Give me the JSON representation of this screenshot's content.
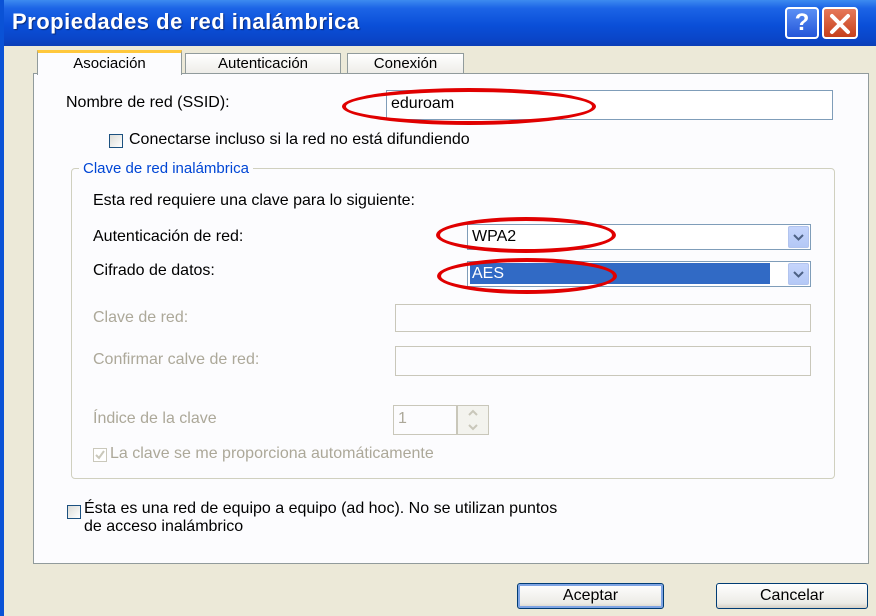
{
  "window": {
    "title": "Propiedades de red inalámbrica",
    "help_label": "?"
  },
  "tabs": [
    {
      "label": "Asociación"
    },
    {
      "label": "Autenticación"
    },
    {
      "label": "Conexión"
    }
  ],
  "ssid": {
    "label": "Nombre de red (SSID):",
    "value": "eduroam"
  },
  "broadcast_checkbox": {
    "label": "Conectarse incluso si la red no está difundiendo",
    "checked": false
  },
  "key_group": {
    "title": "Clave de red inalámbrica",
    "intro": "Esta red requiere una clave para lo siguiente:",
    "auth": {
      "label": "Autenticación de red:",
      "value": "WPA2"
    },
    "encryption": {
      "label": "Cifrado de datos:",
      "value": "AES"
    },
    "network_key": {
      "label": "Clave de red:",
      "value": ""
    },
    "confirm_key": {
      "label": "Confirmar calve de red:",
      "value": ""
    },
    "key_index": {
      "label": "Índice de la clave",
      "value": "1"
    },
    "auto_key": {
      "label": "La clave se me proporciona automáticamente",
      "checked": true
    }
  },
  "adhoc": {
    "line1": "Ésta es una red de equipo a equipo (ad hoc). No se utilizan puntos",
    "line2": "de acceso inalámbrico",
    "checked": false
  },
  "buttons": {
    "ok": "Aceptar",
    "cancel": "Cancelar"
  },
  "colors": {
    "titlebar": "#0a4fd8",
    "highlight": "#316ac5",
    "annotation": "#e00000",
    "group_title": "#0046d5"
  }
}
